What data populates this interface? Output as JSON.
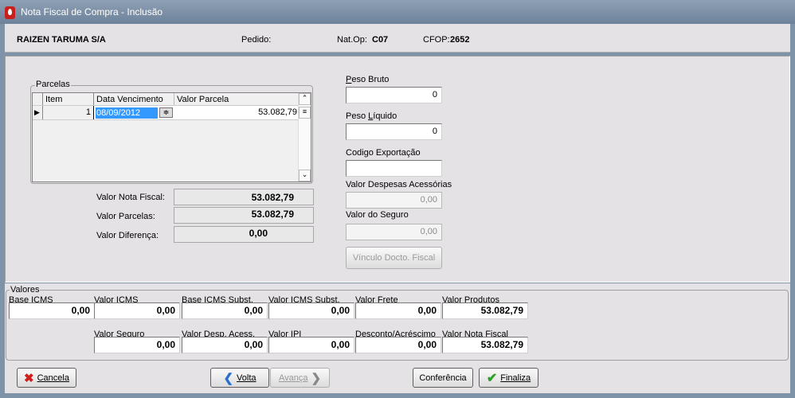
{
  "window": {
    "title": "Nota Fiscal de Compra - Inclusão"
  },
  "header": {
    "company": "RAIZEN TARUMA S/A",
    "pedido_label": "Pedido:",
    "natop_label": "Nat.Op:",
    "natop_value": "C07",
    "cfop_label": "CFOP:",
    "cfop_value": "2652"
  },
  "parcelas": {
    "title": "Parcelas",
    "columns": [
      "Item",
      "Data Vencimento",
      "Valor Parcela"
    ],
    "rows": [
      {
        "item": "1",
        "data": "08/09/2012",
        "valor": "53.082,79"
      }
    ]
  },
  "summary": {
    "nota_label": "Valor Nota Fiscal:",
    "nota_value": "53.082,79",
    "parcelas_label": "Valor Parcelas:",
    "parcelas_value": "53.082,79",
    "diferenca_label": "Valor Diferença:",
    "diferenca_value": "0,00"
  },
  "right": {
    "peso_bruto_label": "Peso Bruto",
    "peso_bruto": "0",
    "peso_liquido_label": "Peso Líquido",
    "peso_liquido": "0",
    "codigo_label": "Codigo Exportação",
    "codigo": "",
    "despesas_label": "Valor Despesas Acessórias",
    "despesas": "0,00",
    "seguro_label": "Valor do Seguro",
    "seguro": "0,00",
    "vinculo_button": "Vínculo Docto. Fiscal"
  },
  "valores": {
    "title": "Valores",
    "row1": [
      {
        "label": "Base ICMS",
        "value": "0,00"
      },
      {
        "label": "Valor ICMS",
        "value": "0,00"
      },
      {
        "label": "Base ICMS Subst.",
        "value": "0,00"
      },
      {
        "label": "Valor ICMS Subst.",
        "value": "0,00"
      },
      {
        "label": "Valor Frete",
        "value": "0,00"
      },
      {
        "label": "Valor Produtos",
        "value": "53.082,79"
      }
    ],
    "row2": [
      {
        "label": "Valor Seguro",
        "value": "0,00"
      },
      {
        "label": "Valor Desp. Acess.",
        "value": "0,00"
      },
      {
        "label": "Valor IPI",
        "value": "0,00"
      },
      {
        "label": "Desconto/Acréscimo",
        "value": "0,00"
      },
      {
        "label": "Valor Nota Fiscal",
        "value": "53.082,79"
      }
    ]
  },
  "buttons": {
    "cancela": "Cancela",
    "volta": "Volta",
    "avanca": "Avança",
    "conferencia": "Conferência",
    "finaliza": "Finaliza"
  }
}
